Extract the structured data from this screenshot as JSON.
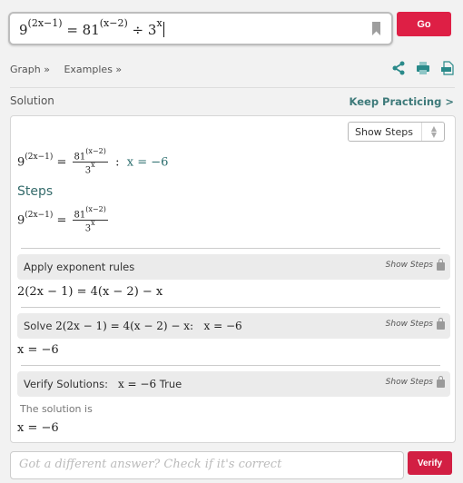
{
  "search": {
    "query_parts": {
      "base1": "9",
      "exp1": "(2x−1)",
      "mid": " = 81",
      "exp2": "(x−2)",
      "div": " ÷ 3",
      "exp3": "x"
    },
    "bookmark_icon": "bookmark-icon",
    "go_label": "Go"
  },
  "links": {
    "graph": "Graph »",
    "examples": "Examples »"
  },
  "tools": {
    "share": "share-icon",
    "print": "print-icon",
    "pdf": "pdf-icon"
  },
  "solution_label": "Solution",
  "keep_practicing": "Keep Practicing >",
  "panel": {
    "select_value": "Show Steps",
    "result": {
      "lhs_base": "9",
      "lhs_exp": "(2x−1)",
      "eq": " = ",
      "num_base": "81",
      "num_exp": "(x−2)",
      "den_base": "3",
      "den_exp": "x",
      "sep": "  :  ",
      "answer": "x = −6"
    },
    "steps_heading": "Steps",
    "steps": [
      {
        "title": "Apply exponent rules",
        "math": "",
        "result": "2(2x − 1) = 4(x − 2) − x",
        "show_steps": "Show Steps"
      },
      {
        "title": "Solve ",
        "math": "2(2x − 1) = 4(x − 2) − x:   x = −6",
        "result": "x = −6",
        "show_steps": "Show Steps"
      },
      {
        "title": "Verify Solutions:   ",
        "math": "x = −6",
        "suffix": " True",
        "show_steps": "Show Steps"
      }
    ],
    "solution_is": "The solution is",
    "final_answer": "x = −6"
  },
  "verify": {
    "placeholder": "Got a different answer? Check if it's correct",
    "button": "Verify"
  },
  "colors": {
    "accent_red": "#de1f45",
    "teal": "#3e7a7a"
  }
}
